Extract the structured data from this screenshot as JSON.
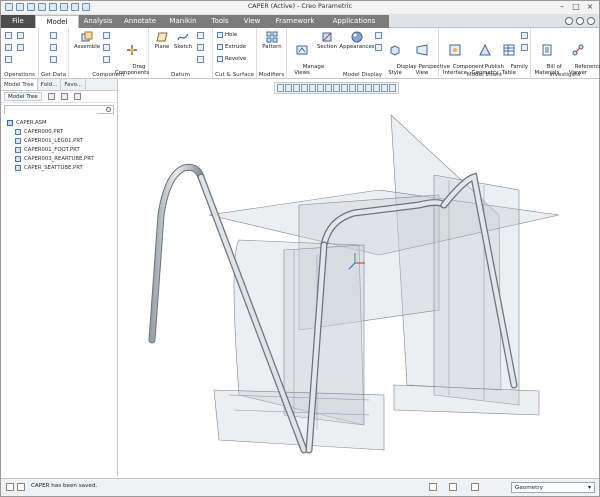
{
  "window": {
    "title": "CAPER (Active) - Creo Parametric"
  },
  "tabs": [
    "File",
    "Model",
    "Analysis",
    "Annotate",
    "Manikin",
    "Tools",
    "View",
    "Framework",
    "Applications"
  ],
  "ribbon": {
    "groups": {
      "operations": "Operations",
      "get_data": "Get Data",
      "component": "Component",
      "datum": "Datum",
      "cut_surface": "Cut & Surface",
      "modifiers": "Modifiers",
      "model_display": "Model Display",
      "model_intent": "Model Intent",
      "investigate": "Investigate"
    },
    "buttons": {
      "assemble": "Assemble",
      "drag_components": "Drag\nComponents",
      "plane": "Plane",
      "sketch": "Sketch",
      "hole": "Hole",
      "extrude": "Extrude",
      "revolve": "Revolve",
      "pattern": "Pattern",
      "manage_views": "Manage\nViews",
      "section": "Section",
      "appearances": "Appearances",
      "display_style": "Display\nStyle",
      "perspective_view": "Perspective\nView",
      "component_interface": "Component\nInterface",
      "publish_geometry": "Publish\nGeometry",
      "family_table": "Family\nTable",
      "bill_of_materials": "Bill of\nMaterials",
      "reference_viewer": "Reference\nViewer"
    }
  },
  "left_panel": {
    "tabs": [
      "Model Tree",
      "Fold...",
      "Favo..."
    ],
    "toolbar_label": "Model Tree",
    "search_placeholder": "",
    "tree": [
      {
        "label": "CAPER.ASM",
        "type": "asm"
      },
      {
        "label": "CAPER000.PRT",
        "type": "prt"
      },
      {
        "label": "CAPER001_LEG01.PRT",
        "type": "prt"
      },
      {
        "label": "CAPER001_FOOT.PRT",
        "type": "prt"
      },
      {
        "label": "CAPER003_REARTUBE.PRT",
        "type": "prt"
      },
      {
        "label": "CAPER_SEATTUBE.PRT",
        "type": "prt"
      }
    ]
  },
  "status": {
    "message": "CAPER has been saved.",
    "filter": "Geometry"
  },
  "colors": {
    "file_tab": "#4d4d4d",
    "tab_bar": "#7c7c7c",
    "accent": "#3b67a3"
  }
}
